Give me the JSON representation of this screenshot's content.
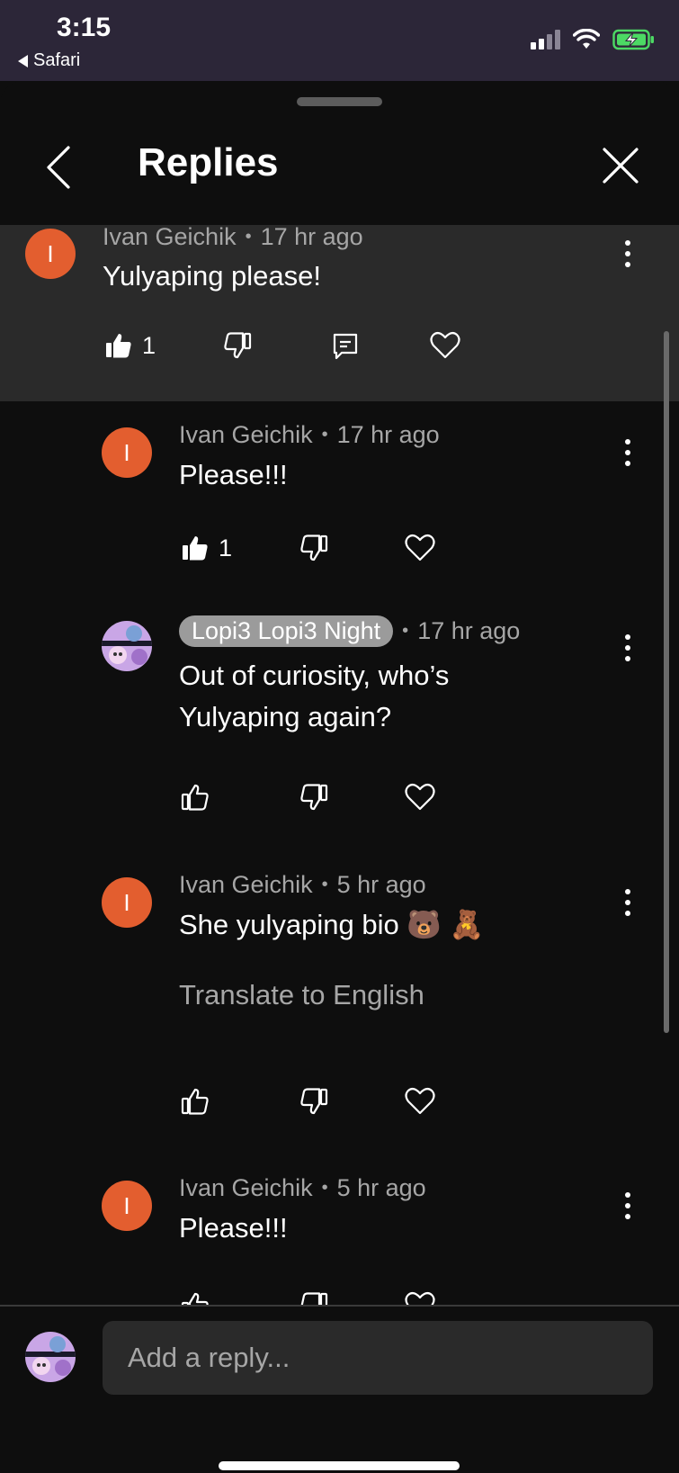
{
  "status_bar": {
    "time": "3:15",
    "back_app": "Safari",
    "battery_color": "#4cd964"
  },
  "header": {
    "title": "Replies"
  },
  "colors": {
    "avatar": "#e35e2f",
    "background": "#0e0e0e",
    "highlight": "#2a2a2a"
  },
  "parent": {
    "author": "Ivan Geichik",
    "time": "17 hr ago",
    "text": "Yulyaping please!",
    "likes": "1"
  },
  "replies": [
    {
      "author": "Ivan Geichik",
      "initial": "I",
      "time": "17 hr ago",
      "text": "Please!!!",
      "likes": "1"
    },
    {
      "author": "Lopi3 Lopi3 Night",
      "time": "17 hr ago",
      "text": "Out of curiosity, who’s Yulyaping again?"
    },
    {
      "author": "Ivan Geichik",
      "initial": "I",
      "time": "5 hr ago",
      "text": "She yulyaping bio 🐻 🧸",
      "translate": "Translate to English"
    },
    {
      "author": "Ivan Geichik",
      "initial": "I",
      "time": "5 hr ago",
      "text": "Please!!!"
    }
  ],
  "composer": {
    "placeholder": "Add a reply..."
  }
}
